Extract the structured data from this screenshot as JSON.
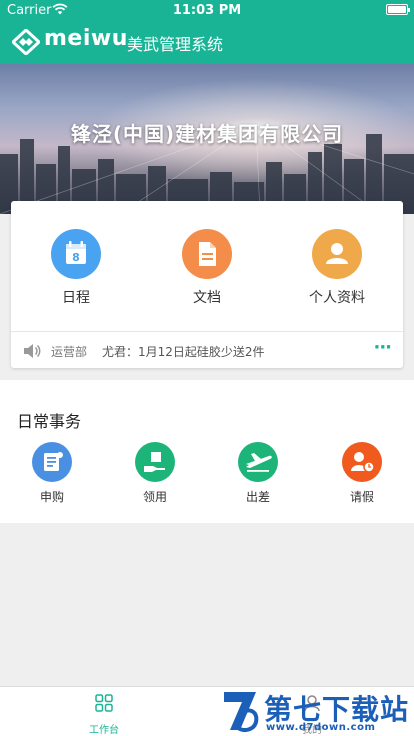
{
  "status_bar": {
    "carrier": "Carrier",
    "time": "11:03 PM"
  },
  "header": {
    "logo_text": "meiwu",
    "app_title": "美武管理系统"
  },
  "banner": {
    "company_name": "锋泾(中国)建材集团有限公司"
  },
  "quick_actions": [
    {
      "label": "日程",
      "icon": "calendar-icon",
      "color": "#4aa3f0",
      "calendar_day": "8"
    },
    {
      "label": "文档",
      "icon": "document-icon",
      "color": "#f58d4a"
    },
    {
      "label": "个人资料",
      "icon": "person-icon",
      "color": "#f0a94a"
    }
  ],
  "notice": {
    "department": "运营部",
    "message": "尤君：1月12日起硅胶少送2件",
    "more": "···"
  },
  "daily_affairs": {
    "heading": "日常事务",
    "items": [
      {
        "label": "申购",
        "icon": "purchase-request-icon",
        "color": "#4a90e2"
      },
      {
        "label": "领用",
        "icon": "receive-item-icon",
        "color": "#1db47a"
      },
      {
        "label": "出差",
        "icon": "airplane-icon",
        "color": "#1db47a"
      },
      {
        "label": "请假",
        "icon": "leave-request-icon",
        "color": "#f05a1e"
      }
    ]
  },
  "tabbar": {
    "tabs": [
      {
        "label": "工作台",
        "icon": "grid-icon",
        "active": true
      },
      {
        "label": "我的",
        "icon": "profile-icon",
        "active": false
      }
    ]
  },
  "watermark": {
    "text": "第七下载站",
    "url": "www.d7down.com"
  },
  "colors": {
    "brand": "#19b496",
    "background": "#efefef"
  }
}
